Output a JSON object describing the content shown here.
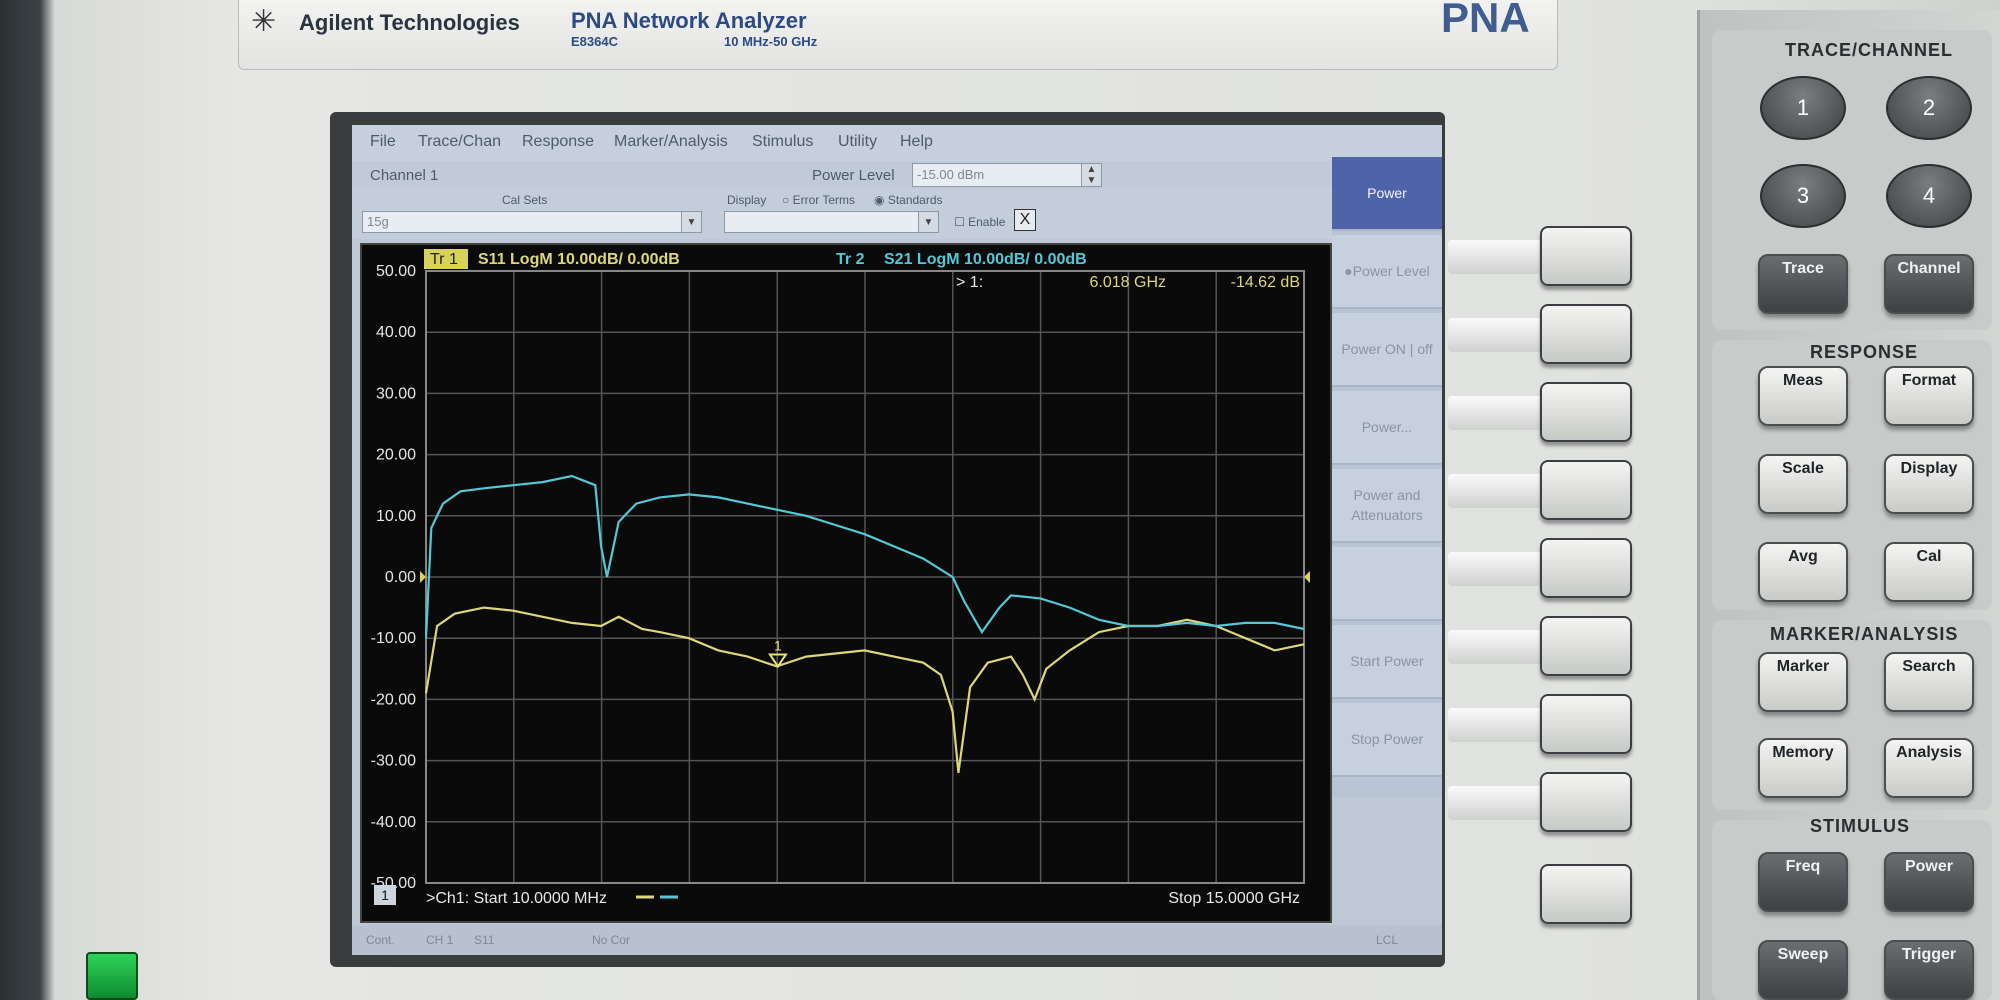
{
  "instrument": {
    "brand": "Agilent Technologies",
    "product": "PNA Network Analyzer",
    "model": "E8364C",
    "range": "10 MHz-50 GHz",
    "badge": "PNA"
  },
  "menu": [
    "File",
    "Trace/Chan",
    "Response",
    "Marker/Analysis",
    "Stimulus",
    "Utility",
    "Help"
  ],
  "toolbar": {
    "channel": "Channel 1",
    "power_label": "Power Level",
    "power_value": "-15.00 dBm",
    "calsets_label": "Cal Sets",
    "calset_value": "15g",
    "display_label": "Display",
    "error_terms": "Error Terms",
    "standards": "Standards",
    "enable": "Enable",
    "close": "X"
  },
  "softkeys": [
    "Power",
    "Power Level",
    "Power ON | off",
    "Power...",
    "Power and Attenuators",
    "",
    "Start Power",
    "Stop Power"
  ],
  "status": {
    "cont": "Cont.",
    "ch": "CH 1",
    "s11": "S11",
    "nocor": "No Cor",
    "lcl": "LCL"
  },
  "chart_data": {
    "type": "line",
    "x_range_ghz": [
      0.01,
      15
    ],
    "ylim": [
      -50,
      50
    ],
    "yticks": [
      "50.00",
      "40.00",
      "30.00",
      "20.00",
      "10.00",
      "0.00",
      "-10.00",
      "-20.00",
      "-30.00",
      "-40.00",
      "-50.00"
    ],
    "ref_level_db": 0,
    "trace1_label": "Tr 1",
    "trace1_desc": "S11 LogM 10.00dB/  0.00dB",
    "trace2_label": "Tr 2",
    "trace2_desc": "S21 LogM 10.00dB/  0.00dB",
    "marker_label": "> 1:",
    "marker_freq": "6.018 GHz",
    "marker_value": "-14.62 dB",
    "marker_id": "1",
    "marker_x_ghz": 6.018,
    "marker_y_db": -14.62,
    "channel_number": "1",
    "start_text": ">Ch1: Start  10.0000 MHz",
    "stop_text": "Stop  15.0000 GHz",
    "colors": {
      "s11": "#dcd77a",
      "s21": "#54c8d6",
      "grid": "#555555",
      "label_bg": "#d8d15a"
    },
    "series": [
      {
        "name": "S11",
        "x": [
          0.01,
          0.2,
          0.5,
          1.0,
          1.5,
          2.0,
          2.5,
          3.0,
          3.3,
          3.7,
          4.0,
          4.5,
          5.0,
          5.5,
          6.0,
          6.5,
          7.0,
          7.5,
          8.0,
          8.5,
          8.8,
          9.0,
          9.1,
          9.3,
          9.6,
          10.0,
          10.2,
          10.4,
          10.6,
          11.0,
          11.5,
          12.0,
          12.5,
          13.0,
          13.5,
          14.0,
          14.5,
          15.0
        ],
        "values": [
          -19,
          -8,
          -6,
          -5,
          -5.5,
          -6.5,
          -7.5,
          -8,
          -6.5,
          -8.5,
          -9,
          -10,
          -12,
          -13,
          -14.6,
          -13,
          -12.5,
          -12,
          -13,
          -14,
          -16,
          -22,
          -32,
          -18,
          -14,
          -13,
          -16,
          -20,
          -15,
          -12,
          -9,
          -8,
          -8,
          -7,
          -8,
          -10,
          -12,
          -11
        ]
      },
      {
        "name": "S21",
        "x": [
          0.01,
          0.1,
          0.3,
          0.6,
          1.0,
          1.5,
          2.0,
          2.5,
          2.9,
          3.0,
          3.1,
          3.3,
          3.6,
          4.0,
          4.5,
          5.0,
          5.5,
          6.0,
          6.5,
          7.0,
          7.5,
          8.0,
          8.5,
          9.0,
          9.2,
          9.5,
          9.8,
          10.0,
          10.5,
          11.0,
          11.5,
          12.0,
          12.5,
          13.0,
          13.5,
          14.0,
          14.5,
          15.0
        ],
        "values": [
          -10,
          8,
          12,
          14,
          14.5,
          15,
          15.5,
          16.5,
          15,
          5,
          0,
          9,
          12,
          13,
          13.5,
          13,
          12,
          11,
          10,
          8.5,
          7,
          5,
          3,
          0,
          -4,
          -9,
          -5,
          -3,
          -3.5,
          -5,
          -7,
          -8,
          -8,
          -7.5,
          -8,
          -7.5,
          -7.5,
          -8.5
        ]
      }
    ]
  }
}
